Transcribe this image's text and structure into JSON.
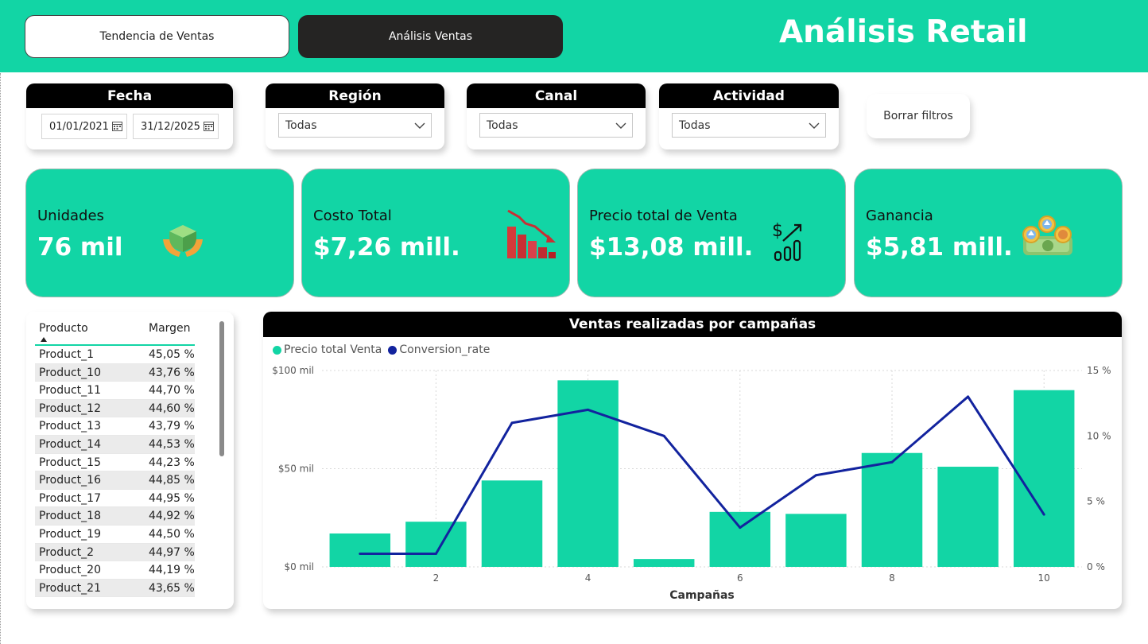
{
  "header": {
    "nav": [
      {
        "label": "Tendencia de Ventas"
      },
      {
        "label": "Análisis Ventas"
      }
    ],
    "title": "Análisis Retail"
  },
  "filters": {
    "fecha": {
      "title": "Fecha",
      "start": "01/01/2021",
      "end": "31/12/2025"
    },
    "region": {
      "title": "Región",
      "value": "Todas"
    },
    "canal": {
      "title": "Canal",
      "value": "Todas"
    },
    "actividad": {
      "title": "Actividad",
      "value": "Todas"
    },
    "clear_label": "Borrar filtros"
  },
  "kpis": [
    {
      "label": "Unidades",
      "value": "76 mil",
      "icon": "box-hands-icon"
    },
    {
      "label": "Costo Total",
      "value": "$7,26 mill.",
      "icon": "declining-bars-icon"
    },
    {
      "label": "Precio total de Venta",
      "value": "$13,08 mill.",
      "icon": "dollar-growth-icon"
    },
    {
      "label": "Ganancia",
      "value": "$5,81 mill.",
      "icon": "money-coins-icon"
    }
  ],
  "table": {
    "headers": [
      "Producto",
      "Margen"
    ],
    "rows": [
      [
        "Product_1",
        "45,05 %"
      ],
      [
        "Product_10",
        "43,76 %"
      ],
      [
        "Product_11",
        "44,70 %"
      ],
      [
        "Product_12",
        "44,60 %"
      ],
      [
        "Product_13",
        "43,79 %"
      ],
      [
        "Product_14",
        "44,53 %"
      ],
      [
        "Product_15",
        "44,23 %"
      ],
      [
        "Product_16",
        "44,85 %"
      ],
      [
        "Product_17",
        "44,95 %"
      ],
      [
        "Product_18",
        "44,92 %"
      ],
      [
        "Product_19",
        "44,50 %"
      ],
      [
        "Product_2",
        "44,97 %"
      ],
      [
        "Product_20",
        "44,19 %"
      ],
      [
        "Product_21",
        "43,65 %"
      ]
    ]
  },
  "colors": {
    "accent": "#12d5a5",
    "line": "#12239e",
    "dark": "#252423"
  },
  "chart_data": {
    "type": "bar",
    "title": "Ventas realizadas por campañas",
    "xlabel": "Campañas",
    "x": [
      1,
      2,
      3,
      4,
      5,
      6,
      7,
      8,
      9,
      10
    ],
    "x_ticks": [
      "2",
      "4",
      "6",
      "8",
      "10"
    ],
    "series": [
      {
        "name": "Precio total Venta",
        "axis": "left",
        "type": "bar",
        "values": [
          17,
          23,
          44,
          95,
          4,
          28,
          27,
          58,
          51,
          90
        ]
      },
      {
        "name": "Conversion_rate",
        "axis": "right",
        "type": "line",
        "values": [
          1,
          1,
          11,
          12,
          10,
          3,
          7,
          8,
          13,
          4
        ]
      }
    ],
    "y_left": {
      "ylim": [
        0,
        100
      ],
      "ticks": [
        "$0 mil",
        "$50 mil",
        "$100 mil"
      ]
    },
    "y_right": {
      "ylim": [
        0,
        15
      ],
      "ticks": [
        "0 %",
        "5 %",
        "10 %",
        "15 %"
      ]
    },
    "grid": true,
    "legend_position": "top-left"
  }
}
